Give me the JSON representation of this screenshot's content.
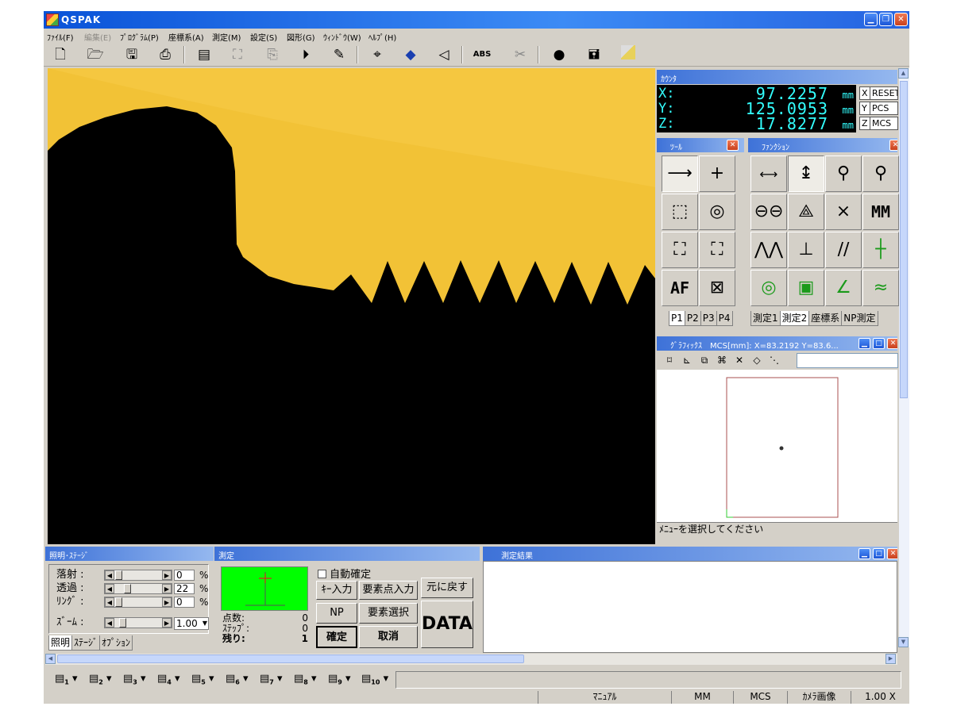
{
  "window": {
    "title": "QSPAK",
    "minimize_icon": "minimize-icon",
    "restore_icon": "restore-icon",
    "close_icon": "close-icon"
  },
  "menu": [
    {
      "label": "ﾌｧｲﾙ(F)",
      "enabled": true
    },
    {
      "label": "編集(E)",
      "enabled": false
    },
    {
      "label": "ﾌﾟﾛｸﾞﾗﾑ(P)",
      "enabled": true
    },
    {
      "label": "座標系(A)",
      "enabled": true
    },
    {
      "label": "測定(M)",
      "enabled": true
    },
    {
      "label": "設定(S)",
      "enabled": true
    },
    {
      "label": "図形(G)",
      "enabled": true
    },
    {
      "label": "ｳｨﾝﾄﾞｳ(W)",
      "enabled": true
    },
    {
      "label": "ﾍﾙﾌﾟ(H)",
      "enabled": true
    }
  ],
  "toolbar": {
    "icons": [
      "new-file-icon",
      "open-folder-icon",
      "save-icon",
      "print-icon",
      "report-icon",
      "run-program-icon",
      "copy-icon",
      "play-icon",
      "edit-program-icon",
      "add-element-icon",
      "eraser-icon",
      "speaker-icon",
      "abs-icon",
      "disabled-tool-icon",
      "record-icon",
      "save-image-icon",
      "color-icon"
    ],
    "abs_label": "ABS"
  },
  "counter": {
    "title": "ｶｳﾝﾀ",
    "axes": [
      {
        "axis": "X:",
        "value": "97.2257",
        "unit": "mm"
      },
      {
        "axis": "Y:",
        "value": "125.0953",
        "unit": "mm"
      },
      {
        "axis": "Z:",
        "value": "17.8277",
        "unit": "mm"
      }
    ],
    "buttons": [
      {
        "axis": "X",
        "label": "RESET"
      },
      {
        "axis": "Y",
        "label": "PCS"
      },
      {
        "axis": "Z",
        "label": "MCS"
      }
    ],
    "display_color": "#33ffff"
  },
  "tool": {
    "title": "ﾂｰﾙ",
    "cells": [
      "line-tool-icon",
      "cross-tool-icon",
      "box-edge-icon",
      "circle-tool-icon",
      "box-corner-icon",
      "box-corner-alt-icon",
      "autofocus-tool",
      "max-box-icon"
    ],
    "af_label": "AF",
    "tabs": [
      "P1",
      "P2",
      "P3",
      "P4"
    ]
  },
  "function": {
    "title": "ﾌｧﾝｸｼｮﾝ",
    "cells": [
      "distance-icon",
      "height-icon",
      "point-circle-icon",
      "point-circle-alt-icon",
      "two-circles-icon",
      "plane-icon",
      "cross-intersect-icon",
      "max-min-label",
      "angle-lines-icon",
      "perpendicular-icon",
      "parallel-icon",
      "green-cross-icon",
      "circle-green-icon",
      "square-green-icon",
      "angle-green-icon",
      "wave-green-icon"
    ],
    "mm_label": "MM",
    "tabs": [
      "測定1",
      "測定2",
      "座標系",
      "NP測定"
    ]
  },
  "graphics": {
    "title": "ｸﾞﾗﾌｨｯｸｽ　MCS[mm]: X=83.2192 Y=83.6...",
    "toolbar_icons": [
      "fit-icon",
      "trim-icon",
      "copy-shape-icon",
      "move-icon",
      "delete-icon",
      "eraser-icon",
      "dimension-icon"
    ],
    "status": "ﾒﾆｭｰを選択してください"
  },
  "lighting": {
    "title": "照明･ｽﾃｰｼﾞ",
    "rows": [
      {
        "label": "落射 :",
        "value": "0",
        "unit": "%",
        "level": 0
      },
      {
        "label": "透過 :",
        "value": "22",
        "unit": "%",
        "level": 22
      },
      {
        "label": "ﾘﾝｸﾞ :",
        "value": "0",
        "unit": "%",
        "level": 0
      }
    ],
    "zoom_label": "ｽﾞｰﾑ :",
    "zoom_value": "1.00",
    "tabs": [
      "照明",
      "ｽﾃｰｼﾞ",
      "ｵﾌﾟｼｮﾝ"
    ]
  },
  "measure": {
    "title": "測定",
    "auto_confirm": "自動確定",
    "key_input": "ｷｰ入力",
    "element_point_input": "要素点入力",
    "np": "NP",
    "element_select": "要素選択",
    "confirm": "確定",
    "cancel": "取消",
    "back": "元に戻す",
    "data": "DATA",
    "stats": [
      {
        "label": "点数:",
        "value": "0"
      },
      {
        "label": "ｽﾃｯﾌﾟ:",
        "value": "0"
      },
      {
        "label": "残り:",
        "value": "1"
      }
    ]
  },
  "result": {
    "title": "測定結果"
  },
  "programs": {
    "count": 10,
    "labels": [
      "1",
      "2",
      "3",
      "4",
      "5",
      "6",
      "7",
      "8",
      "9",
      "10"
    ]
  },
  "status": {
    "mode": "ﾏﾆｭｱﾙ",
    "unit": "MM",
    "coord": "MCS",
    "view": "ｶﾒﾗ画像",
    "zoom": "1.00 X"
  }
}
